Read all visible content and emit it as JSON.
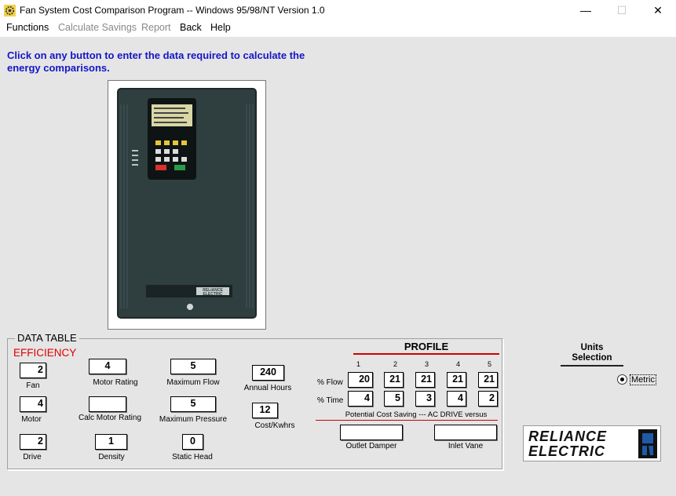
{
  "window": {
    "title": "Fan System Cost Comparison Program -- Windows 95/98/NT Version 1.0",
    "minimize_glyph": "—",
    "maximize_glyph": "☐",
    "close_glyph": "✕"
  },
  "menu": {
    "functions": "Functions",
    "calculate_savings": "Calculate Savings",
    "report": "Report",
    "back": "Back",
    "help": "Help"
  },
  "instruction": "Click on any button to enter the data required to calculate the energy comparisons.",
  "drive_image": {
    "brand_plate": "RELIANCE ELECTRIC"
  },
  "data_table": {
    "legend": "DATA TABLE",
    "efficiency_title": "EFFICIENCY",
    "fan": {
      "value": "2",
      "label": "Fan"
    },
    "motor": {
      "value": "4",
      "label": "Motor"
    },
    "drive": {
      "value": "2",
      "label": "Drive"
    },
    "motor_rating": {
      "value": "4",
      "label": "Motor Rating"
    },
    "calc_motor_rating": {
      "value": "",
      "label": "Calc Motor Rating"
    },
    "density": {
      "value": "1",
      "label": "Density"
    },
    "maximum_flow": {
      "value": "5",
      "label": "Maximum Flow"
    },
    "maximum_pressure": {
      "value": "5",
      "label": "Maximum Pressure"
    },
    "static_head": {
      "value": "0",
      "label": "Static Head"
    },
    "annual_hours": {
      "value": "240",
      "label": "Annual Hours"
    },
    "cost_kwhrs": {
      "value": "12",
      "label": "Cost/Kwhrs"
    }
  },
  "profile": {
    "title": "PROFILE",
    "columns": [
      "1",
      "2",
      "3",
      "4",
      "5"
    ],
    "flow_label": "% Flow",
    "time_label": "% Time",
    "flow_values": [
      "20",
      "21",
      "21",
      "21",
      "21"
    ],
    "time_values": [
      "4",
      "5",
      "3",
      "4",
      "2"
    ],
    "savings_caption": "Potential Cost Saving --- AC DRIVE versus",
    "outlet_damper": {
      "value": "",
      "label": "Outlet Damper"
    },
    "inlet_vane": {
      "value": "",
      "label": "Inlet Vane"
    }
  },
  "units": {
    "title": "Units Selection",
    "option": "Metric",
    "selected": true
  },
  "logo": {
    "line1": "RELIANCE",
    "line2": "ELECTRIC"
  },
  "colors": {
    "instruction": "#1515c8",
    "accent_red": "#e00000",
    "drive_body": "#2f3e3f"
  }
}
